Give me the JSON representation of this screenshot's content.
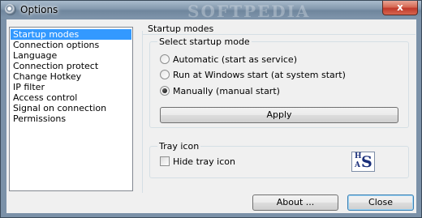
{
  "window": {
    "title": "Options",
    "close_label": "x",
    "watermark": "SOFTPEDIA"
  },
  "sidebar": {
    "items": [
      {
        "label": "Startup modes",
        "selected": true
      },
      {
        "label": "Connection options",
        "selected": false
      },
      {
        "label": "Language",
        "selected": false
      },
      {
        "label": "Connection protect",
        "selected": false
      },
      {
        "label": "Change Hotkey",
        "selected": false
      },
      {
        "label": "IP filter",
        "selected": false
      },
      {
        "label": "Access control",
        "selected": false
      },
      {
        "label": "Signal on connection",
        "selected": false
      },
      {
        "label": "Permissions",
        "selected": false
      }
    ]
  },
  "panel": {
    "title": "Startup modes",
    "startup_group": {
      "title": "Select startup mode",
      "options": [
        {
          "label": "Automatic (start as service)",
          "checked": false
        },
        {
          "label": "Run at Windows start (at system start)",
          "checked": false
        },
        {
          "label": "Manually (manual start)",
          "checked": true
        }
      ],
      "apply_label": "Apply"
    },
    "tray_group": {
      "title": "Tray icon",
      "hide_tray_label": "Hide tray icon",
      "hide_tray_checked": false,
      "logo_letters": [
        "H",
        "A",
        "S"
      ]
    }
  },
  "footer": {
    "about_label": "About ...",
    "close_label": "Close"
  },
  "colors": {
    "selection": "#3399ff",
    "frame": "#7b91a8",
    "close_button": "#c0392b"
  }
}
